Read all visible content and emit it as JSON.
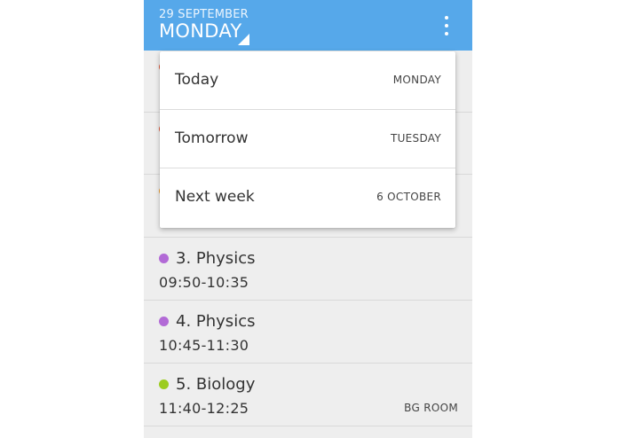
{
  "header": {
    "date_small": "29 SEPTEMBER",
    "day_label": "MONDAY",
    "accent_color": "#56a8ea",
    "more_icon": "more-vertical-icon"
  },
  "menu": {
    "options": [
      {
        "label": "Today",
        "detail": "MONDAY"
      },
      {
        "label": "Tomorrow",
        "detail": "TUESDAY"
      },
      {
        "label": "Next week",
        "detail": "6 OCTOBER"
      }
    ]
  },
  "schedule": {
    "items": [
      {
        "title": "3. Physics",
        "time": "09:50-10:35",
        "room": "",
        "color": "#b26ad6"
      },
      {
        "title": "4. Physics",
        "time": "10:45-11:30",
        "room": "",
        "color": "#b26ad6"
      },
      {
        "title": "5. Biology",
        "time": "11:40-12:25",
        "room": "BG ROOM",
        "color": "#9ccc1e"
      }
    ]
  }
}
